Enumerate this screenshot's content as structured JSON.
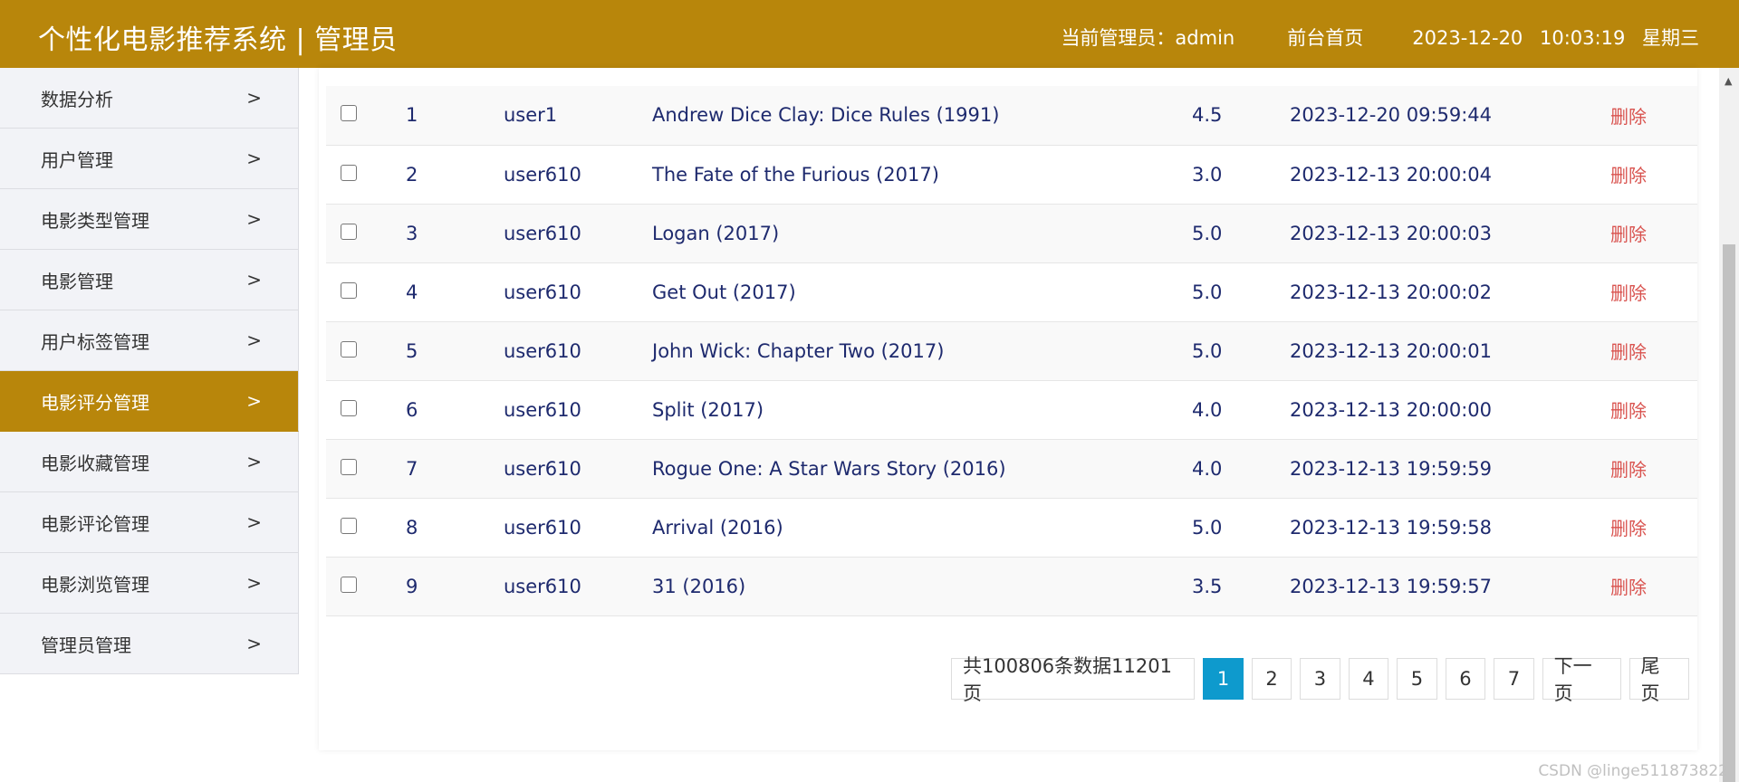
{
  "header": {
    "title": "个性化电影推荐系统 | 管理员",
    "admin_label": "当前管理员：admin",
    "front_link": "前台首页",
    "date": "2023-12-20",
    "time": "10:03:19",
    "weekday": "星期三"
  },
  "sidebar": {
    "items": [
      {
        "label": "数据分析"
      },
      {
        "label": "用户管理"
      },
      {
        "label": "电影类型管理"
      },
      {
        "label": "电影管理"
      },
      {
        "label": "用户标签管理"
      },
      {
        "label": "电影评分管理"
      },
      {
        "label": "电影收藏管理"
      },
      {
        "label": "电影评论管理"
      },
      {
        "label": "电影浏览管理"
      },
      {
        "label": "管理员管理"
      }
    ],
    "active_index": 5,
    "chevron": ">"
  },
  "table": {
    "rows": [
      {
        "id": "1",
        "user": "user1",
        "movie": "Andrew Dice Clay: Dice Rules (1991)",
        "score": "4.5",
        "time": "2023-12-20 09:59:44",
        "action": "删除"
      },
      {
        "id": "2",
        "user": "user610",
        "movie": "The Fate of the Furious (2017)",
        "score": "3.0",
        "time": "2023-12-13 20:00:04",
        "action": "删除"
      },
      {
        "id": "3",
        "user": "user610",
        "movie": "Logan (2017)",
        "score": "5.0",
        "time": "2023-12-13 20:00:03",
        "action": "删除"
      },
      {
        "id": "4",
        "user": "user610",
        "movie": "Get Out (2017)",
        "score": "5.0",
        "time": "2023-12-13 20:00:02",
        "action": "删除"
      },
      {
        "id": "5",
        "user": "user610",
        "movie": "John Wick: Chapter Two (2017)",
        "score": "5.0",
        "time": "2023-12-13 20:00:01",
        "action": "删除"
      },
      {
        "id": "6",
        "user": "user610",
        "movie": "Split (2017)",
        "score": "4.0",
        "time": "2023-12-13 20:00:00",
        "action": "删除"
      },
      {
        "id": "7",
        "user": "user610",
        "movie": "Rogue One: A Star Wars Story (2016)",
        "score": "4.0",
        "time": "2023-12-13 19:59:59",
        "action": "删除"
      },
      {
        "id": "8",
        "user": "user610",
        "movie": "Arrival (2016)",
        "score": "5.0",
        "time": "2023-12-13 19:59:58",
        "action": "删除"
      },
      {
        "id": "9",
        "user": "user610",
        "movie": "31 (2016)",
        "score": "3.5",
        "time": "2023-12-13 19:59:57",
        "action": "删除"
      }
    ]
  },
  "pagination": {
    "info": "共100806条数据11201页",
    "pages": [
      "1",
      "2",
      "3",
      "4",
      "5",
      "6",
      "7"
    ],
    "current": "1",
    "next_label": "下一页",
    "last_label": "尾页"
  },
  "watermark": "CSDN @linge511873822",
  "colors": {
    "brand": "#b8860b",
    "active_page": "#0e9acd",
    "delete_link": "#d9534f",
    "table_text": "#1e2a6e"
  },
  "icons": {
    "chevron": "chevron-right-icon",
    "scroll_up": "scroll-up-arrow-icon"
  }
}
